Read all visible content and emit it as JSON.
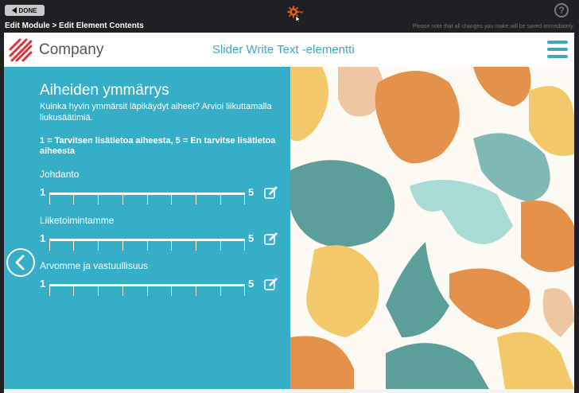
{
  "toolbar": {
    "done_label": "DONE",
    "breadcrumb": "Edit Module > Edit Element Contents",
    "notice": "Please note that all changes you make will be saved immediately.",
    "help_label": "?"
  },
  "header": {
    "company": "Company",
    "title": "Slider Write Text -elementti"
  },
  "content": {
    "heading": "Aiheiden ymmärrys",
    "intro": "Kuinka hyvin ymmärsit läpikäydyt aiheet? Arvioi liikuttamalla liukusäätimiä.",
    "scale_text": "1 = Tarvitsen lisätietoa aiheesta, 5 = En tarvitse lisätietoa aiheesta",
    "sliders": [
      {
        "label": "Johdanto",
        "min": "1",
        "max": "5"
      },
      {
        "label": "Liiketoimintamme",
        "min": "1",
        "max": "5"
      },
      {
        "label": "Arvomme ja vastuullisuus",
        "min": "1",
        "max": "5"
      }
    ]
  },
  "colors": {
    "accent": "#36aec8",
    "title": "#3ea8bf",
    "logo": "#d9323a"
  },
  "icons": {
    "settings": "gear-icon",
    "edit": "edit-icon",
    "back": "chevron-left-icon",
    "menu": "hamburger-menu-icon"
  }
}
